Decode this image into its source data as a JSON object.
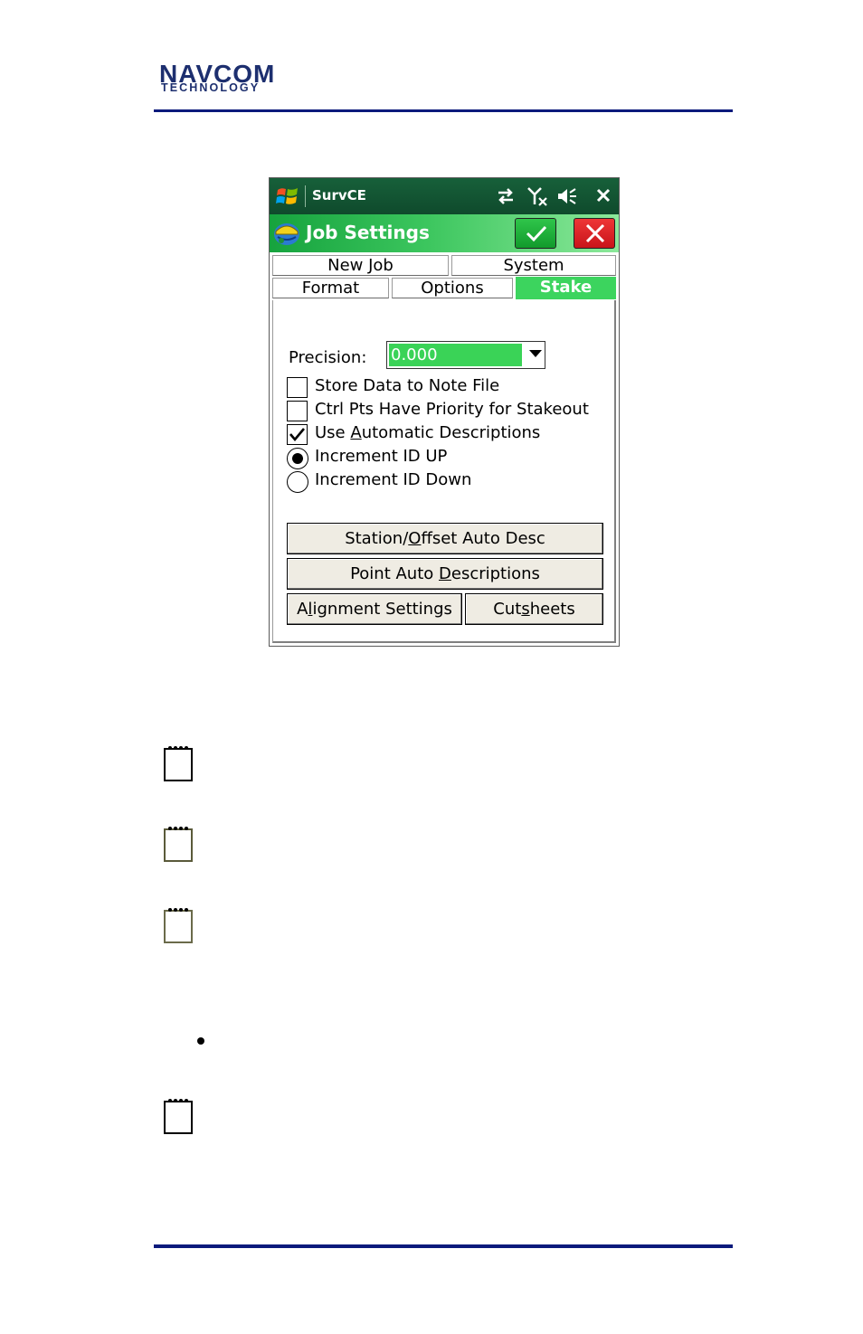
{
  "header": {
    "logo_main": "NAVCOM",
    "logo_sub": "TECHNOLOGY"
  },
  "device": {
    "statusbar": {
      "app_name": "SurvCE",
      "icons": [
        "windows-logo-icon",
        "connectivity-icon",
        "no-signal-icon",
        "speaker-muted-icon",
        "close-icon"
      ]
    },
    "titlebar": {
      "title": "Job Settings",
      "ok_icon": "checkmark-icon",
      "cancel_icon": "x-icon"
    },
    "tabs": {
      "row1": [
        {
          "label": "New Job"
        },
        {
          "label": "System"
        }
      ],
      "row2": [
        {
          "label": "Format"
        },
        {
          "label": "Options"
        },
        {
          "label": "Stake",
          "active": true
        }
      ]
    },
    "precision": {
      "label": "Precision:",
      "value": "0.000"
    },
    "checkboxes": [
      {
        "label": "Store Data to Note File",
        "checked": false
      },
      {
        "label": "Ctrl Pts Have Priority for Stakeout",
        "checked": false
      },
      {
        "label": "Use Automatic Descriptions",
        "checked": true
      }
    ],
    "radios": [
      {
        "label": "Increment ID UP",
        "selected": true
      },
      {
        "label": "Increment ID Down",
        "selected": false
      }
    ],
    "buttons": {
      "station_offset": {
        "pre": "Station/",
        "ul": "O",
        "post": "ffset Auto Desc"
      },
      "point_auto": {
        "pre": "Point Auto ",
        "ul": "D",
        "post": "escriptions"
      },
      "alignment": {
        "pre": "A",
        "ul": "l",
        "post": "ignment Settings"
      },
      "cutsheets": {
        "pre": "Cut",
        "ul": "s",
        "post": "heets"
      }
    },
    "colors": {
      "statusbar": "#0f4a2c",
      "titlebar_accent": "#16a33e",
      "active_tab": "#3cd45e",
      "ok_button": "#129a2c",
      "cancel_button": "#c8141a"
    }
  },
  "notes": {
    "icon": "notepad-icon",
    "count": 4
  },
  "bullet_icon": "bullet-icon"
}
